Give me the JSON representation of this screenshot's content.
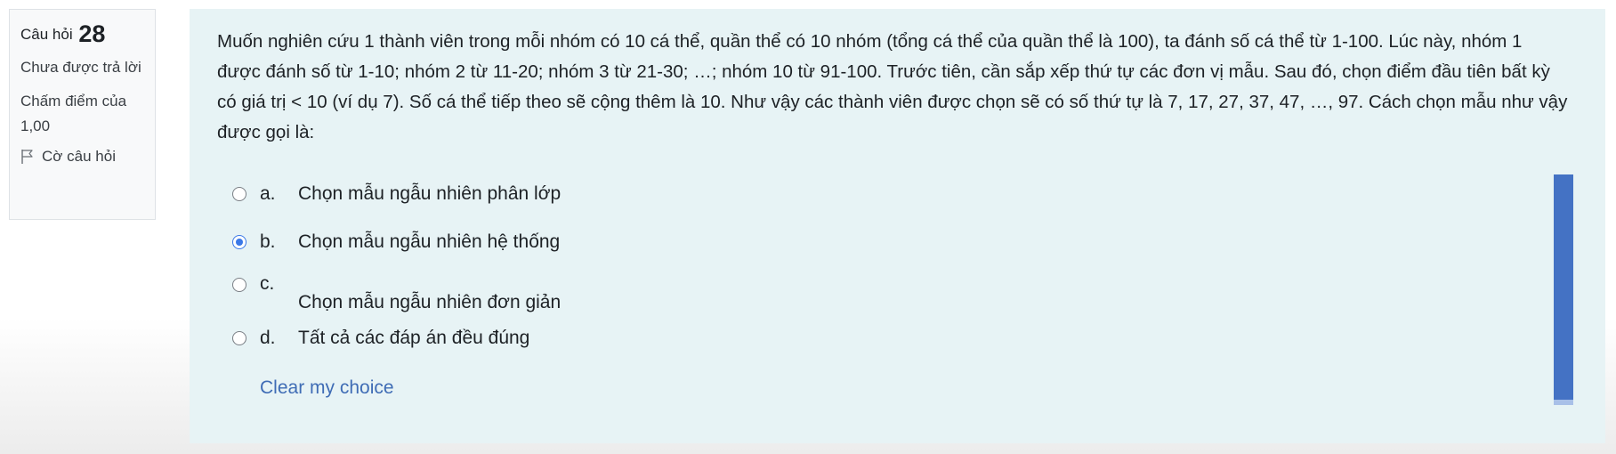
{
  "info": {
    "question_label": "Câu hỏi",
    "question_number": "28",
    "state": "Chưa được trả lời",
    "grade_label": "Chấm điểm của 1,00",
    "flag_label": "Cờ câu hỏi"
  },
  "question": {
    "text": "Muốn nghiên cứu 1 thành viên trong mỗi nhóm có 10 cá thể, quần thể có 10 nhóm (tổng cá thể của quần thể là 100), ta đánh số cá thể từ 1-100. Lúc này, nhóm 1 được đánh số từ 1-10; nhóm 2 từ 11-20; nhóm 3 từ 21-30; …; nhóm 10 từ 91-100. Trước tiên, cần sắp xếp thứ tự các đơn vị mẫu. Sau đó, chọn điểm đầu tiên bất kỳ có giá trị < 10 (ví dụ 7). Số cá thể tiếp theo sẽ cộng thêm là 10. Như vậy các thành viên được chọn sẽ có số thứ tự là 7, 17, 27, 37, 47, …, 97. Cách chọn mẫu như vậy được gọi là:"
  },
  "answers": [
    {
      "letter": "a.",
      "text": "Chọn mẫu ngẫu nhiên phân lớp",
      "selected": false
    },
    {
      "letter": "b.",
      "text": "Chọn mẫu ngẫu nhiên hệ thống",
      "selected": true
    },
    {
      "letter": "c.",
      "text": "Chọn mẫu ngẫu nhiên đơn giản",
      "selected": false
    },
    {
      "letter": "d.",
      "text": "Tất cả các đáp án đều đúng",
      "selected": false
    }
  ],
  "clear_label": "Clear my choice",
  "colors": {
    "accent": "#3b78e7",
    "link": "#3f6cb5",
    "content_bg": "#e7f3f5",
    "scrollbar": "#4472c4"
  }
}
